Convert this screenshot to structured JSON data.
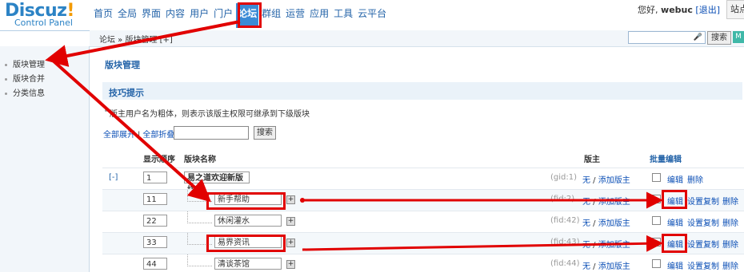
{
  "header": {
    "logo_word": "Discuz",
    "logo_bang": "!",
    "logo_sub": "Control Panel",
    "nav": [
      "首页",
      "全局",
      "界面",
      "内容",
      "用户",
      "门户",
      "论坛",
      "群组",
      "运营",
      "应用",
      "工具",
      "云平台"
    ],
    "active_tab": "论坛",
    "greeting": "您好,",
    "username": "webuc",
    "logout": "[退出]",
    "site_btn": "站点"
  },
  "crumb": {
    "text": "论坛 » 版块管理 [+]"
  },
  "search": {
    "button": "搜索",
    "m": "M"
  },
  "sidebar": {
    "items": [
      {
        "label": "版块管理"
      },
      {
        "label": "版块合并"
      },
      {
        "label": "分类信息"
      }
    ]
  },
  "main": {
    "title": "版块管理",
    "tips_title": "技巧提示",
    "tip": "版主用户名为粗体，则表示该版主权限可继承到下级版块",
    "expand_all": "全部展开",
    "collapse_all": "全部折叠",
    "filter_btn": "搜索",
    "headers": {
      "order": "显示顺序",
      "name": "版块名称",
      "moderator": "版主",
      "batch": "批量编辑"
    },
    "rows": [
      {
        "toggle": "[-]",
        "order": "1",
        "name": "易之道欢迎新版块",
        "fid": "(gid:1)",
        "mod_none": "无",
        "mod_sep": " / ",
        "mod_add": "添加版主",
        "edit": "编辑",
        "dup": "",
        "del": "删除"
      },
      {
        "toggle": "",
        "order": "11",
        "name": "新手帮助",
        "fid": "(fid:2)",
        "mod_none": "无",
        "mod_sep": " / ",
        "mod_add": "添加版主",
        "edit": "编辑",
        "dup": "设置复制",
        "del": "删除"
      },
      {
        "toggle": "",
        "order": "22",
        "name": "休闲灌水",
        "fid": "(fid:42)",
        "mod_none": "无",
        "mod_sep": " / ",
        "mod_add": "添加版主",
        "edit": "编辑",
        "dup": "设置复制",
        "del": "删除"
      },
      {
        "toggle": "",
        "order": "33",
        "name": "易界资讯",
        "fid": "(fid:43)",
        "mod_none": "无",
        "mod_sep": " / ",
        "mod_add": "添加版主",
        "edit": "编辑",
        "dup": "设置复制",
        "del": "删除"
      },
      {
        "toggle": "",
        "order": "44",
        "name": "清谈茶馆",
        "fid": "(fid:44)",
        "mod_none": "无",
        "mod_sep": " / ",
        "mod_add": "添加版主",
        "edit": "编辑",
        "dup": "设置复制",
        "del": "删除"
      }
    ]
  },
  "annotation": {
    "color": "#e10000"
  }
}
